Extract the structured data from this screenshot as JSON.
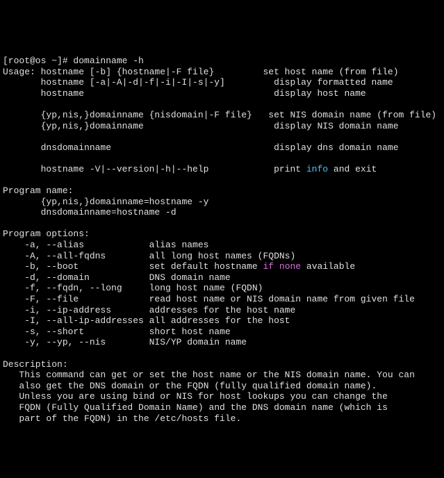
{
  "prompt": "[root@os ~]# domainname -h",
  "usage_header": "Usage: hostname [-b] {hostname|-F file}         set host name (from file)",
  "usage_lines": [
    "       hostname [-a|-A|-d|-f|-i|-I|-s|-y]         display formatted name",
    "       hostname                                   display host name",
    "",
    "       {yp,nis,}domainname {nisdomain|-F file}   set NIS domain name (from file)",
    "       {yp,nis,}domainname                        display NIS domain name",
    "",
    "       dnsdomainname                              display dns domain name",
    ""
  ],
  "usage_version_prefix": "       hostname -V|--version|-h|--help            print ",
  "usage_version_info": "info",
  "usage_version_suffix": " and exit",
  "program_name_header": "Program name:",
  "program_name_lines": [
    "       {yp,nis,}domainname=hostname -y",
    "       dnsdomainname=hostname -d"
  ],
  "program_options_header": "Program options:",
  "options": [
    "    -a, --alias            alias names",
    "    -A, --all-fqdns        all long host names (FQDNs)"
  ],
  "option_boot_prefix": "    -b, --boot             set default hostname ",
  "option_boot_if": "if",
  "option_boot_mid": " ",
  "option_boot_none": "none",
  "option_boot_suffix": " available",
  "options2": [
    "    -d, --domain           DNS domain name",
    "    -f, --fqdn, --long     long host name (FQDN)",
    "    -F, --file             read host name or NIS domain name from given file",
    "    -i, --ip-address       addresses for the host name",
    "    -I, --all-ip-addresses all addresses for the host",
    "    -s, --short            short host name",
    "    -y, --yp, --nis        NIS/YP domain name"
  ],
  "description_header": "Description:",
  "description_lines": [
    "   This command can get or set the host name or the NIS domain name. You can",
    "   also get the DNS domain or the FQDN (fully qualified domain name).",
    "   Unless you are using bind or NIS for host lookups you can change the",
    "   FQDN (Fully Qualified Domain Name) and the DNS domain name (which is",
    "   part of the FQDN) in the /etc/hosts file."
  ]
}
